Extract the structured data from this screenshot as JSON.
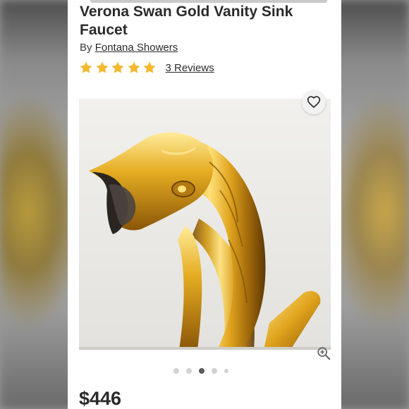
{
  "product": {
    "title": "Verona Swan Gold Vanity Sink Faucet",
    "by_prefix": "By",
    "brand": "Fontana Showers",
    "rating_stars": 5,
    "reviews_label": "3 Reviews",
    "price": "$446"
  },
  "gallery": {
    "slide_count": 5,
    "active_slide": 3
  },
  "icons": {
    "wishlist": "heart-icon",
    "zoom": "zoom-in-icon",
    "star": "star-icon"
  },
  "colors": {
    "star": "#f5b82e",
    "text": "#2b2b2b",
    "gold": "#d9a521",
    "active_dot": "#5b5b5b",
    "inactive_dot": "#d2d2d2"
  }
}
